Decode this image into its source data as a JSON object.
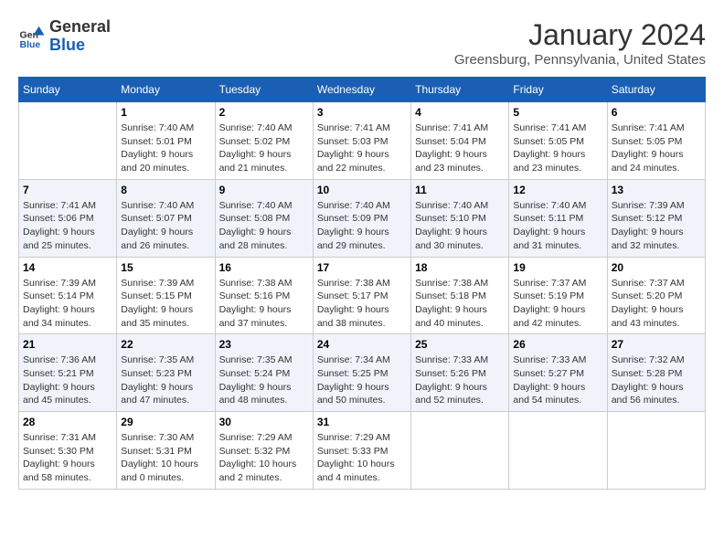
{
  "header": {
    "logo_line1": "General",
    "logo_line2": "Blue",
    "month": "January 2024",
    "location": "Greensburg, Pennsylvania, United States"
  },
  "days_of_week": [
    "Sunday",
    "Monday",
    "Tuesday",
    "Wednesday",
    "Thursday",
    "Friday",
    "Saturday"
  ],
  "weeks": [
    [
      {
        "num": "",
        "info": ""
      },
      {
        "num": "1",
        "info": "Sunrise: 7:40 AM\nSunset: 5:01 PM\nDaylight: 9 hours\nand 20 minutes."
      },
      {
        "num": "2",
        "info": "Sunrise: 7:40 AM\nSunset: 5:02 PM\nDaylight: 9 hours\nand 21 minutes."
      },
      {
        "num": "3",
        "info": "Sunrise: 7:41 AM\nSunset: 5:03 PM\nDaylight: 9 hours\nand 22 minutes."
      },
      {
        "num": "4",
        "info": "Sunrise: 7:41 AM\nSunset: 5:04 PM\nDaylight: 9 hours\nand 23 minutes."
      },
      {
        "num": "5",
        "info": "Sunrise: 7:41 AM\nSunset: 5:05 PM\nDaylight: 9 hours\nand 23 minutes."
      },
      {
        "num": "6",
        "info": "Sunrise: 7:41 AM\nSunset: 5:05 PM\nDaylight: 9 hours\nand 24 minutes."
      }
    ],
    [
      {
        "num": "7",
        "info": "Sunrise: 7:41 AM\nSunset: 5:06 PM\nDaylight: 9 hours\nand 25 minutes."
      },
      {
        "num": "8",
        "info": "Sunrise: 7:40 AM\nSunset: 5:07 PM\nDaylight: 9 hours\nand 26 minutes."
      },
      {
        "num": "9",
        "info": "Sunrise: 7:40 AM\nSunset: 5:08 PM\nDaylight: 9 hours\nand 28 minutes."
      },
      {
        "num": "10",
        "info": "Sunrise: 7:40 AM\nSunset: 5:09 PM\nDaylight: 9 hours\nand 29 minutes."
      },
      {
        "num": "11",
        "info": "Sunrise: 7:40 AM\nSunset: 5:10 PM\nDaylight: 9 hours\nand 30 minutes."
      },
      {
        "num": "12",
        "info": "Sunrise: 7:40 AM\nSunset: 5:11 PM\nDaylight: 9 hours\nand 31 minutes."
      },
      {
        "num": "13",
        "info": "Sunrise: 7:39 AM\nSunset: 5:12 PM\nDaylight: 9 hours\nand 32 minutes."
      }
    ],
    [
      {
        "num": "14",
        "info": "Sunrise: 7:39 AM\nSunset: 5:14 PM\nDaylight: 9 hours\nand 34 minutes."
      },
      {
        "num": "15",
        "info": "Sunrise: 7:39 AM\nSunset: 5:15 PM\nDaylight: 9 hours\nand 35 minutes."
      },
      {
        "num": "16",
        "info": "Sunrise: 7:38 AM\nSunset: 5:16 PM\nDaylight: 9 hours\nand 37 minutes."
      },
      {
        "num": "17",
        "info": "Sunrise: 7:38 AM\nSunset: 5:17 PM\nDaylight: 9 hours\nand 38 minutes."
      },
      {
        "num": "18",
        "info": "Sunrise: 7:38 AM\nSunset: 5:18 PM\nDaylight: 9 hours\nand 40 minutes."
      },
      {
        "num": "19",
        "info": "Sunrise: 7:37 AM\nSunset: 5:19 PM\nDaylight: 9 hours\nand 42 minutes."
      },
      {
        "num": "20",
        "info": "Sunrise: 7:37 AM\nSunset: 5:20 PM\nDaylight: 9 hours\nand 43 minutes."
      }
    ],
    [
      {
        "num": "21",
        "info": "Sunrise: 7:36 AM\nSunset: 5:21 PM\nDaylight: 9 hours\nand 45 minutes."
      },
      {
        "num": "22",
        "info": "Sunrise: 7:35 AM\nSunset: 5:23 PM\nDaylight: 9 hours\nand 47 minutes."
      },
      {
        "num": "23",
        "info": "Sunrise: 7:35 AM\nSunset: 5:24 PM\nDaylight: 9 hours\nand 48 minutes."
      },
      {
        "num": "24",
        "info": "Sunrise: 7:34 AM\nSunset: 5:25 PM\nDaylight: 9 hours\nand 50 minutes."
      },
      {
        "num": "25",
        "info": "Sunrise: 7:33 AM\nSunset: 5:26 PM\nDaylight: 9 hours\nand 52 minutes."
      },
      {
        "num": "26",
        "info": "Sunrise: 7:33 AM\nSunset: 5:27 PM\nDaylight: 9 hours\nand 54 minutes."
      },
      {
        "num": "27",
        "info": "Sunrise: 7:32 AM\nSunset: 5:28 PM\nDaylight: 9 hours\nand 56 minutes."
      }
    ],
    [
      {
        "num": "28",
        "info": "Sunrise: 7:31 AM\nSunset: 5:30 PM\nDaylight: 9 hours\nand 58 minutes."
      },
      {
        "num": "29",
        "info": "Sunrise: 7:30 AM\nSunset: 5:31 PM\nDaylight: 10 hours\nand 0 minutes."
      },
      {
        "num": "30",
        "info": "Sunrise: 7:29 AM\nSunset: 5:32 PM\nDaylight: 10 hours\nand 2 minutes."
      },
      {
        "num": "31",
        "info": "Sunrise: 7:29 AM\nSunset: 5:33 PM\nDaylight: 10 hours\nand 4 minutes."
      },
      {
        "num": "",
        "info": ""
      },
      {
        "num": "",
        "info": ""
      },
      {
        "num": "",
        "info": ""
      }
    ]
  ]
}
